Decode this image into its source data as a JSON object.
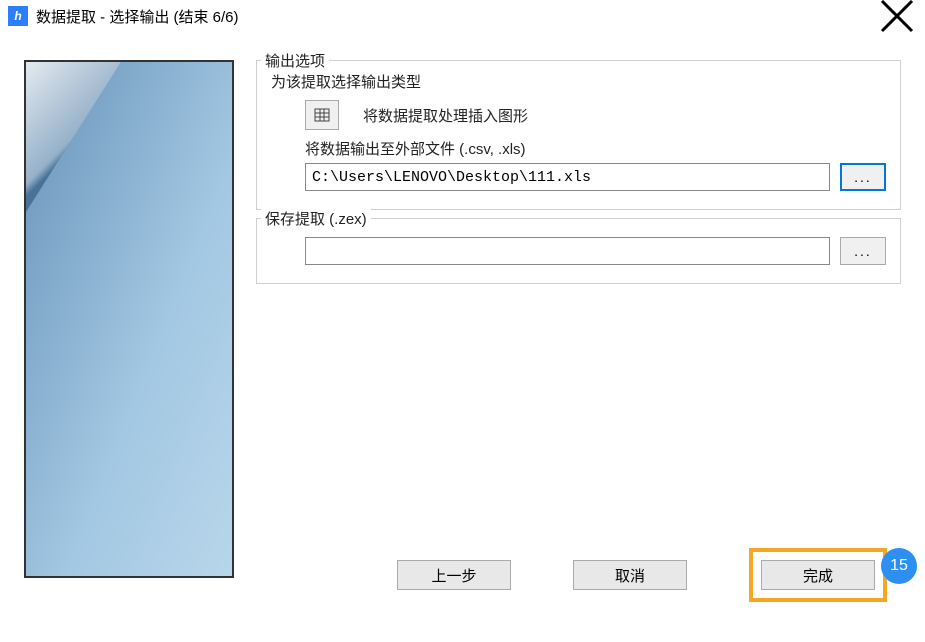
{
  "window": {
    "title": "数据提取 - 选择输出 (结束 6/6)"
  },
  "output": {
    "legend": "输出选项",
    "subtitle": "为该提取选择输出类型",
    "insert_label": "将数据提取处理插入图形",
    "export_label": "将数据输出至外部文件 (.csv, .xls)",
    "path": "C:\\Users\\LENOVO\\Desktop\\111.xls",
    "browse": "..."
  },
  "save": {
    "legend": "保存提取 (.zex)",
    "path": "",
    "browse": "..."
  },
  "footer": {
    "prev": "上一步",
    "cancel": "取消",
    "finish": "完成"
  },
  "annotation": {
    "badge": "15"
  }
}
